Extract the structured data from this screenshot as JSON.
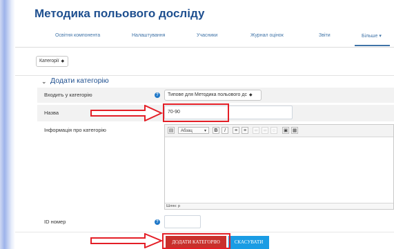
{
  "page": {
    "title": "Методика польового досліду"
  },
  "tabs": [
    {
      "label": "Освітня компонента"
    },
    {
      "label": "Налаштування"
    },
    {
      "label": "Учасники"
    },
    {
      "label": "Журнал оцінок"
    },
    {
      "label": "Звіти"
    },
    {
      "label": "Більше ▾"
    }
  ],
  "category_selector": {
    "value": "Категорії"
  },
  "section": {
    "title": "Додати категорію"
  },
  "form": {
    "parent_label": "Входить у категорію",
    "parent_value": "Типове для Методика польового дс",
    "name_label": "Назва",
    "name_value": "70-90",
    "info_label": "Інформація про категорію",
    "id_label": "ID номер",
    "id_value": ""
  },
  "editor": {
    "format_value": "Абзац",
    "status_path": "Шлях: p",
    "toolbar_buttons": [
      "B",
      "I"
    ]
  },
  "buttons": {
    "submit_label": "ДОДАТИ КАТЕГОРІЮ",
    "cancel_label": "СКАСУВАТИ"
  },
  "colors": {
    "accent": "#1e4f8f",
    "annotation_red": "#e41e26",
    "submit": "#c9302c",
    "cancel": "#1a9ce4"
  }
}
